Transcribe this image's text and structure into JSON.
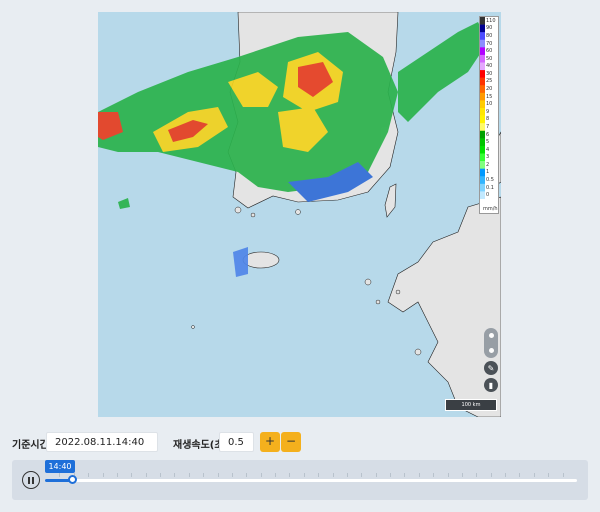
{
  "legend": {
    "ticks": [
      "110",
      "90",
      "80",
      "70",
      "60",
      "50",
      "40",
      "30",
      "25",
      "20",
      "15",
      "10",
      "9",
      "8",
      "7",
      "6",
      "5",
      "4",
      "3",
      "2",
      "1",
      "0.5",
      "0.1",
      "0"
    ],
    "unit": "mm/h",
    "colors": [
      "#333333",
      "#000090",
      "#4c4cff",
      "#8c8cff",
      "#b100ff",
      "#d466ff",
      "#e5a6ff",
      "#ff0000",
      "#ff3300",
      "#ff6600",
      "#ff9900",
      "#ffcc00",
      "#ffe600",
      "#fff200",
      "#fffb66",
      "#00a000",
      "#00c400",
      "#00e000",
      "#33ff33",
      "#80ff80",
      "#0099ff",
      "#33b5ff",
      "#80d3ff",
      "#c2e9ff"
    ]
  },
  "map": {
    "scale_label": "100 km",
    "colors": {
      "sea": "#b7d9ea",
      "land": "#e4e4e4",
      "border": "#222222"
    }
  },
  "controls": {
    "base_time_label": "기준시간",
    "base_time_value": "2022.08.11.14:40",
    "speed_label": "재생속도(초)",
    "speed_value": "0.5",
    "plus_label": "+",
    "minus_label": "−"
  },
  "player": {
    "current_time": "14:40",
    "progress": 0.05,
    "tick_count": 36,
    "accent": "#1e6fd9"
  }
}
